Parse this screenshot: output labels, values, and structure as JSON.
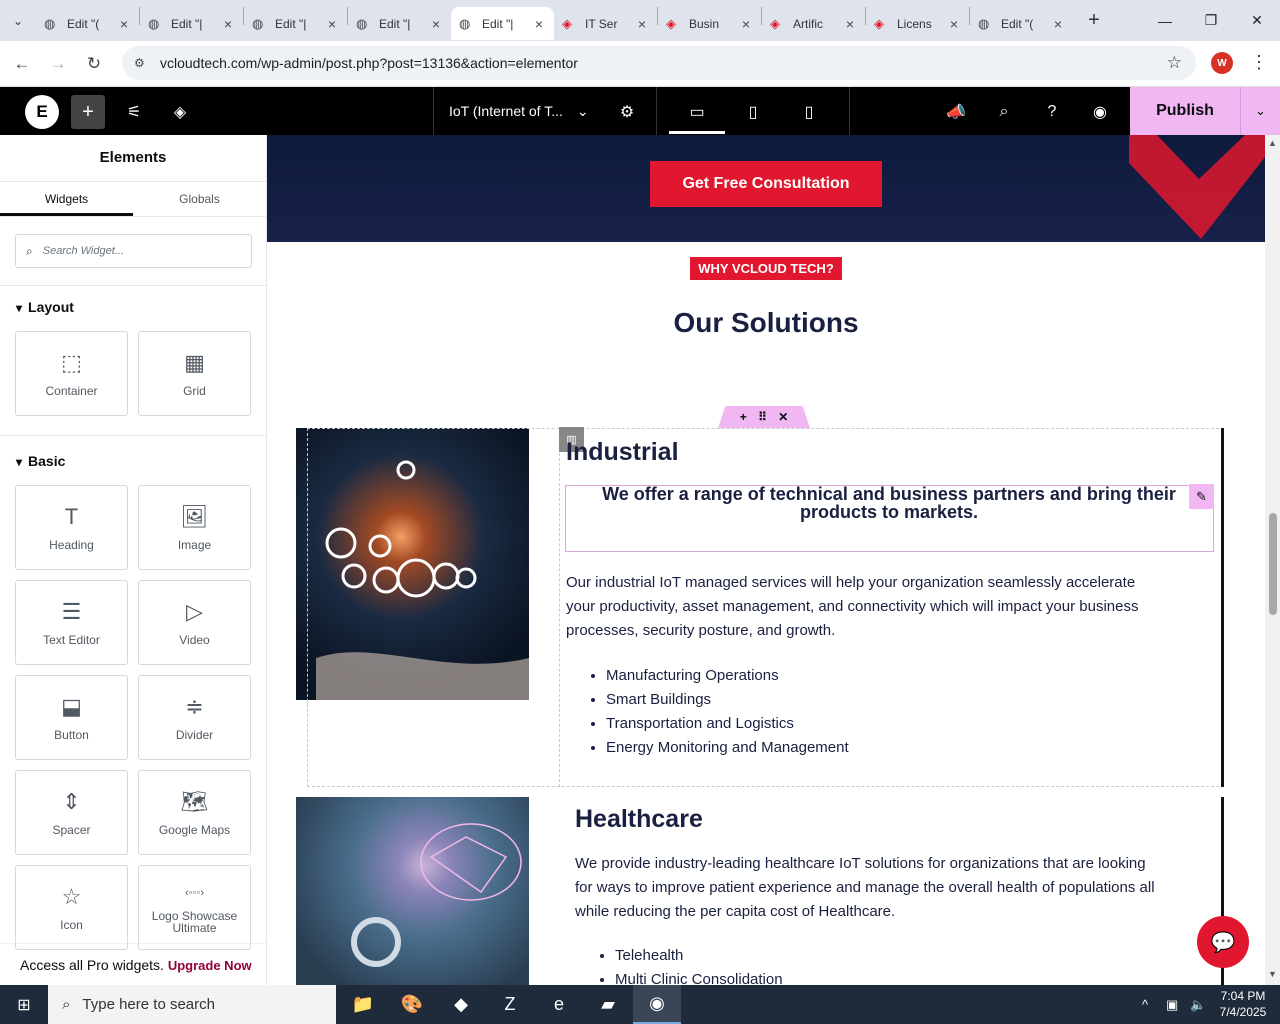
{
  "browser": {
    "tabs": [
      {
        "label": "Edit \"(",
        "icon": "globe-icon",
        "active": false
      },
      {
        "label": "Edit \"|",
        "icon": "globe-icon",
        "active": false
      },
      {
        "label": "Edit \"|",
        "icon": "globe-icon",
        "active": false
      },
      {
        "label": "Edit \"|",
        "icon": "globe-icon",
        "active": false
      },
      {
        "label": "Edit \"|",
        "icon": "globe-icon",
        "active": true
      },
      {
        "label": "IT Ser",
        "icon": "vcloud-icon",
        "active": false
      },
      {
        "label": "Busin",
        "icon": "vcloud-icon",
        "active": false
      },
      {
        "label": "Artific",
        "icon": "vcloud-icon",
        "active": false
      },
      {
        "label": "Licens",
        "icon": "vcloud-icon",
        "active": false
      },
      {
        "label": "Edit \"(",
        "icon": "globe-icon",
        "active": false
      }
    ],
    "url": "vcloudtech.com/wp-admin/post.php?post=13136&action=elementor",
    "profile_initial": "W"
  },
  "editor": {
    "document_title": "IoT (Internet of T...",
    "publish_label": "Publish"
  },
  "panel": {
    "title": "Elements",
    "tabs": [
      "Widgets",
      "Globals"
    ],
    "search_placeholder": "Search Widget...",
    "layout_heading": "Layout",
    "basic_heading": "Basic",
    "layout_widgets": [
      "Container",
      "Grid"
    ],
    "basic_widgets": [
      "Heading",
      "Image",
      "Text Editor",
      "Video",
      "Button",
      "Divider",
      "Spacer",
      "Google Maps",
      "Icon",
      "Logo Showcase Ultimate"
    ],
    "promo_text": "Access all Pro widgets.",
    "promo_link": "Upgrade Now"
  },
  "page": {
    "cta_label": "Get Free Consultation",
    "badge": "WHY VCLOUD TECH?",
    "section_title": "Our Solutions",
    "industrial": {
      "title": "Industrial",
      "quote": "We offer a range of technical and business partners and bring their products to markets.",
      "paragraph": "Our industrial IoT managed services will help your organization seamlessly accelerate your productivity, asset management, and connectivity which will impact your business processes, security posture, and growth.",
      "items": [
        "Manufacturing Operations",
        "Smart Buildings",
        "Transportation and Logistics",
        "Energy Monitoring and Management"
      ]
    },
    "healthcare": {
      "title": "Healthcare",
      "paragraph": "We provide industry-leading healthcare IoT solutions for organizations that are looking for ways to improve patient experience and manage the overall health of populations all while reducing the per capita cost of Healthcare.",
      "items": [
        "Telehealth",
        "Multi Clinic Consolidation"
      ]
    }
  },
  "taskbar": {
    "search_placeholder": "Type here to search",
    "time": "7:04 PM",
    "date": "7/4/2025"
  },
  "colors": {
    "accent_red": "#e0172f",
    "publish_pink": "#f0b7f3",
    "heading_navy": "#1a2040"
  }
}
